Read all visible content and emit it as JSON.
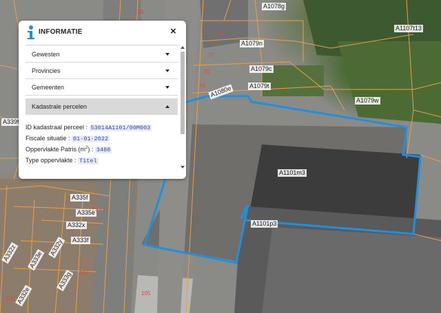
{
  "panel": {
    "title": "INFORMATIE",
    "close_icon": "close-icon",
    "info_icon": "info-icon",
    "sections": [
      {
        "label": "Gewesten",
        "expanded": false
      },
      {
        "label": "Provincies",
        "expanded": false
      },
      {
        "label": "Gemeenten",
        "expanded": false
      },
      {
        "label": "Kadastrale percelen",
        "expanded": true
      }
    ],
    "details": [
      {
        "label": "ID kadastraal perceel :",
        "value": "53014A1101/00M003"
      },
      {
        "label": "Fiscale situatie :",
        "value": "01-01-2022"
      },
      {
        "label_pre": "Oppervlakte Patris (m",
        "label_sup": "2",
        "label_post": ") :",
        "value": "3488"
      },
      {
        "label": "Type oppervlakte :",
        "value": "Titel"
      }
    ]
  },
  "map": {
    "selection_color": "#1e90e0",
    "parcel_line_color": "#f0a040",
    "parcel_labels": [
      "A1078g",
      "A1107t13",
      "A1079n",
      "A1079c",
      "A1079t",
      "A1080e",
      "A1079w",
      "A1101m3",
      "A1101p3",
      "A339f",
      "A335f",
      "A335e",
      "A332x",
      "A332y",
      "A333f",
      "A333e",
      "A332z",
      "A332e",
      "A333g"
    ],
    "house_numbers": [
      "183",
      "79",
      "77",
      "79",
      "81",
      "73",
      "187",
      "188",
      "105"
    ]
  }
}
